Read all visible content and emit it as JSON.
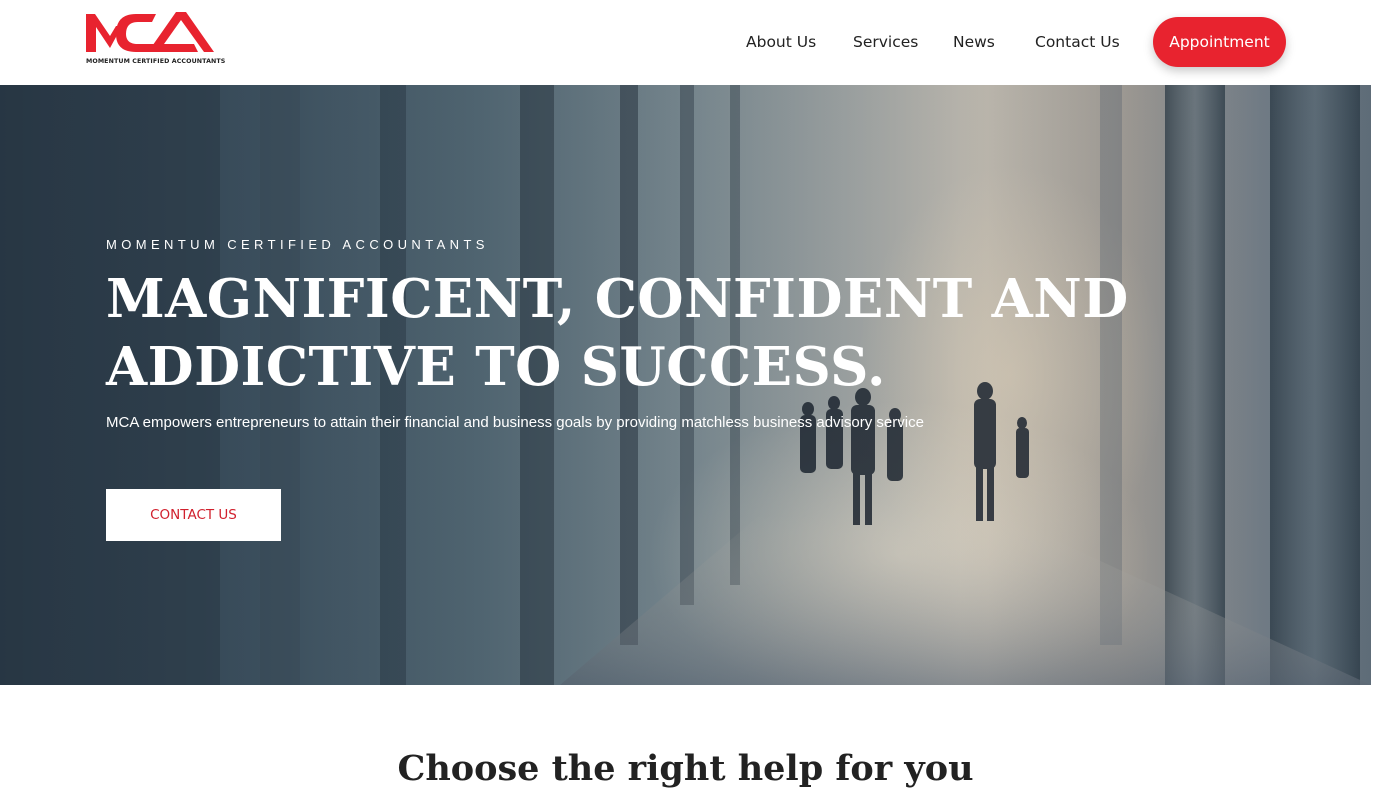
{
  "brand": {
    "logo_text": "MCA",
    "logo_caption": "MOMENTUM CERTIFIED ACCOUNTANTS",
    "accent_color": "#e8232f"
  },
  "nav": {
    "items": [
      {
        "label": "About Us"
      },
      {
        "label": "Services"
      },
      {
        "label": "News"
      },
      {
        "label": "Contact Us"
      }
    ],
    "cta_label": "Appointment"
  },
  "hero": {
    "eyebrow": "MOMENTUM CERTIFIED ACCOUNTANTS",
    "headline": "MAGNIFICENT, CONFIDENT AND ADDICTIVE TO SUCCESS.",
    "subtext": "MCA empowers entrepreneurs to attain their financial and business goals by providing matchless business advisory service",
    "button_label": "CONTACT US"
  },
  "section": {
    "title": "Choose the right help for you"
  }
}
